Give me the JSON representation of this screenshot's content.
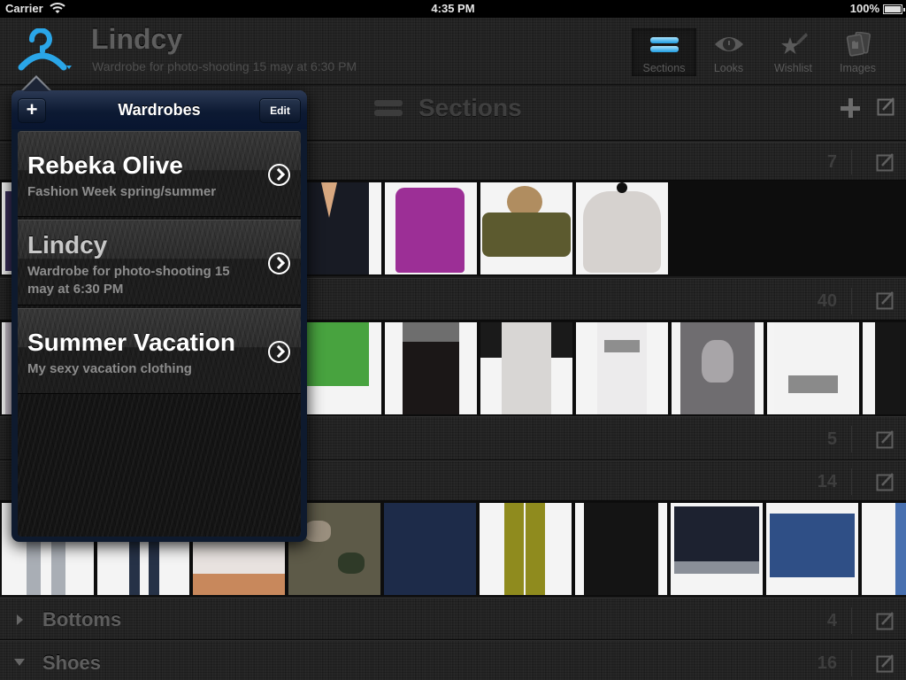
{
  "status_bar": {
    "carrier": "Carrier",
    "time": "4:35 PM",
    "battery": "100%"
  },
  "header": {
    "title": "Lindcy",
    "subtitle": "Wardrobe for photo-shooting 15 may at 6:30 PM",
    "logo_icon": "hanger-icon",
    "tabs": [
      {
        "label": "Sections",
        "icon": "sections-icon",
        "active": true
      },
      {
        "label": "Looks",
        "icon": "eye-icon",
        "active": false
      },
      {
        "label": "Wishlist",
        "icon": "shooting-star-icon",
        "active": false
      },
      {
        "label": "Images",
        "icon": "photos-icon",
        "active": false
      }
    ]
  },
  "toolbar": {
    "title": "Sections",
    "add_icon": "plus-icon",
    "edit_icon": "edit-icon"
  },
  "accent_color": "#2aa6e8",
  "sections": [
    {
      "name": "",
      "count": "7",
      "expanded": true
    },
    {
      "name": "",
      "count": "40",
      "expanded": true
    },
    {
      "name": "",
      "count": "5",
      "expanded": false
    },
    {
      "name": "",
      "count": "14",
      "expanded": true
    },
    {
      "name": "Bottoms",
      "count": "4",
      "expanded": false
    },
    {
      "name": "Shoes",
      "count": "16",
      "expanded": true
    }
  ],
  "thumbnails": {
    "outerwear": [
      "black blazer",
      "purple puffer vest",
      "camo fur-hood jacket",
      "white fur vest"
    ],
    "tops": [
      "green floral long-sleeve",
      "black distressed dress",
      "white dress with black sleeves",
      "white Faith tank",
      "grey skull tee",
      "white FASHION v-neck tee",
      "black top"
    ],
    "bottoms": [
      "light grey jeans",
      "dark blue jeans",
      "white denim cut-offs",
      "camo skirt",
      "denim mini skirt",
      "yellow leopard leggings",
      "black zip hoodie",
      "dark denim shorts",
      "blue denim shorts",
      "blue jeans"
    ]
  },
  "popover": {
    "title": "Wardrobes",
    "add_label": "+",
    "edit_label": "Edit",
    "items": [
      {
        "name": "Rebeka Olive",
        "description": "Fashion Week spring/summer",
        "selected": false
      },
      {
        "name": "Lindcy",
        "description": "Wardrobe for photo-shooting 15 may at 6:30 PM",
        "selected": true
      },
      {
        "name": "Summer Vacation",
        "description": "My sexy vacation clothing",
        "selected": false
      }
    ]
  }
}
